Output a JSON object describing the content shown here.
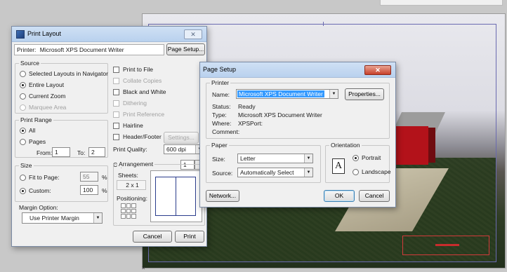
{
  "print_layout": {
    "title": "Print Layout",
    "close_glyph": "✕",
    "printer_label": "Printer:",
    "printer_value": "Microsoft XPS Document Writer",
    "page_setup_button": "Page Setup...",
    "source": {
      "legend": "Source",
      "options": [
        "Selected Layouts in Navigator",
        "Entire Layout",
        "Current Zoom",
        "Marquee Area"
      ],
      "selected": "Entire Layout"
    },
    "print_options": {
      "print_to_file": "Print to File",
      "collate_copies": "Collate Copies",
      "black_and_white": "Black and White",
      "dithering": "Dithering",
      "print_reference": "Print Reference",
      "hairline": "Hairline",
      "header_footer": "Header/Footer",
      "settings_button": "Settings...",
      "print_quality_label": "Print Quality:",
      "print_quality_value": "600 dpi"
    },
    "print_range": {
      "legend": "Print Range",
      "all": "All",
      "pages": "Pages",
      "from_label": "From:",
      "from_value": "1",
      "to_label": "To:",
      "to_value": "2"
    },
    "copies_label": "Copies:",
    "copies_value": "1",
    "size": {
      "legend": "Size",
      "fit_to_page": "Fit to Page:",
      "fit_value": "55",
      "custom": "Custom:",
      "custom_value": "100",
      "percent": "%",
      "selected": "Custom:"
    },
    "arrangement": {
      "legend": "Arrangement",
      "sheets_label": "Sheets:",
      "sheets_value": "2 x 1",
      "positioning_label": "Positioning:"
    },
    "margin_option_label": "Margin Option:",
    "margin_option_value": "Use Printer Margin",
    "cancel_button": "Cancel",
    "print_button": "Print"
  },
  "page_setup": {
    "title": "Page Setup",
    "close_glyph": "✕",
    "printer": {
      "legend": "Printer",
      "name_label": "Name:",
      "name_value": "Microsoft XPS Document Writer",
      "properties_button": "Properties...",
      "status_label": "Status:",
      "status_value": "Ready",
      "type_label": "Type:",
      "type_value": "Microsoft XPS Document Writer",
      "where_label": "Where:",
      "where_value": "XPSPort:",
      "comment_label": "Comment:",
      "comment_value": ""
    },
    "paper": {
      "legend": "Paper",
      "size_label": "Size:",
      "size_value": "Letter",
      "source_label": "Source:",
      "source_value": "Automatically Select"
    },
    "orientation": {
      "legend": "Orientation",
      "portrait": "Portrait",
      "landscape": "Landscape",
      "selected": "Portrait",
      "icon_letter": "A"
    },
    "network_button": "Network...",
    "ok_button": "OK",
    "cancel_button": "Cancel"
  },
  "viewport": {
    "corner_marker": "×"
  }
}
